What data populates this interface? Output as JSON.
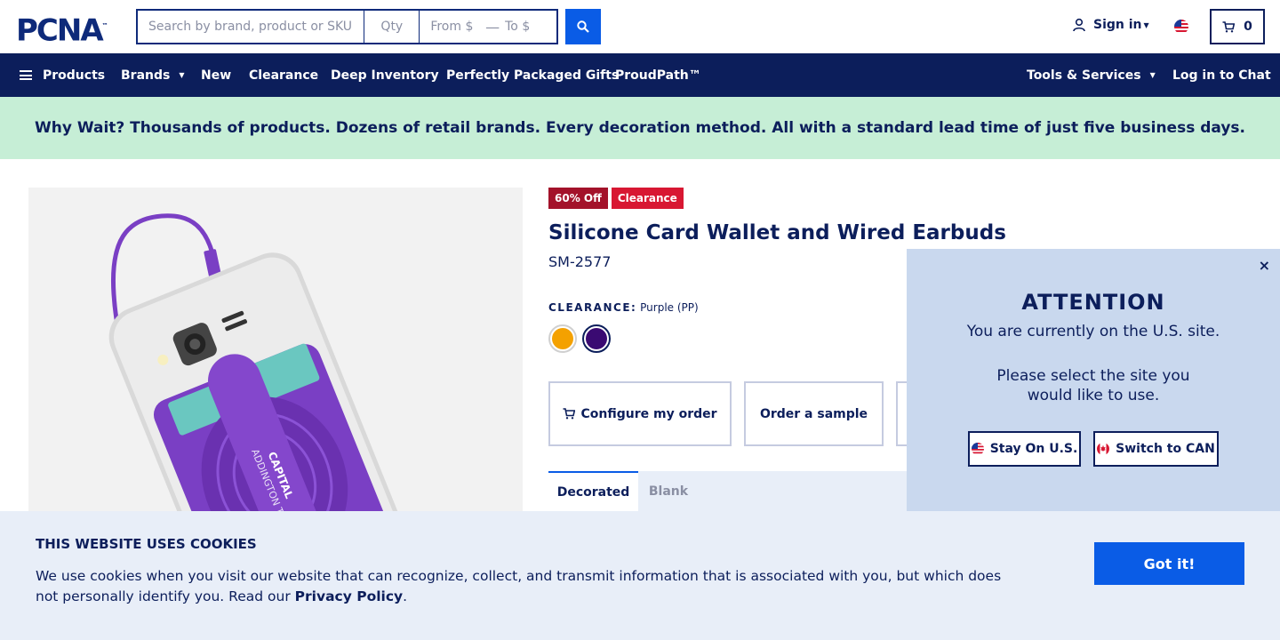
{
  "header": {
    "logo_text": "PCNA",
    "logo_tm": "™",
    "search_placeholder": "Search by brand, product or SKU",
    "qty_placeholder": "Qty",
    "from_placeholder": "From $",
    "range_dash": "—",
    "to_placeholder": "To $",
    "search_icon": "search-icon",
    "signin_label": "Sign in",
    "signin_icon": "user-icon",
    "flag_icon": "us-flag-icon",
    "cart_count": "0",
    "cart_icon": "cart-icon"
  },
  "navbar": {
    "products": "Products",
    "brands": "Brands",
    "new": "New",
    "clearance": "Clearance",
    "deep_inventory": "Deep Inventory",
    "gifts": "Perfectly Packaged Gifts",
    "proudpath": "ProudPath™",
    "tools": "Tools & Services",
    "chat": "Log in to Chat"
  },
  "promo": {
    "text": "Why Wait? Thousands of products. Dozens of retail brands. Every decoration method. All with a standard lead time of just five business days."
  },
  "product": {
    "image_text_1": "ADDINGTON TRUST",
    "image_text_2": "CAPITAL",
    "badge_discount": "60% Off",
    "badge_clearance": "Clearance",
    "title": "Silicone Card Wallet and Wired Earbuds",
    "sku": "SM-2577",
    "clearance_label": "CLEARANCE:",
    "selected_color": "Purple (PP)",
    "swatches": [
      {
        "name": "Orange",
        "color": "#f4a100"
      },
      {
        "name": "Purple",
        "color": "#3a0a72"
      }
    ],
    "configure_label": "Configure my order",
    "sample_label": "Order a sample",
    "tab_decorated": "Decorated",
    "tab_blank": "Blank"
  },
  "modal": {
    "title": "ATTENTION",
    "subtitle": "You are currently on the U.S. site.",
    "question": "Please select the site you would like to use.",
    "stay_label": "Stay On U.S.",
    "switch_label": "Switch to CAN",
    "close": "×"
  },
  "cookie": {
    "title": "THIS WEBSITE USES COOKIES",
    "text": "We use cookies when you visit our website that can recognize, collect, and transmit information that is associated with you, but which does not personally identify you. Read our",
    "link": "Privacy Policy",
    "period": ".",
    "button": "Got it!"
  },
  "colors": {
    "navy": "#0c1e5b",
    "accent_blue": "#0a5ce6",
    "promo_green": "#c6eed6",
    "badge_red_dark": "#a3122a",
    "badge_red": "#d81732",
    "product_purple": "#7a3fc4"
  }
}
